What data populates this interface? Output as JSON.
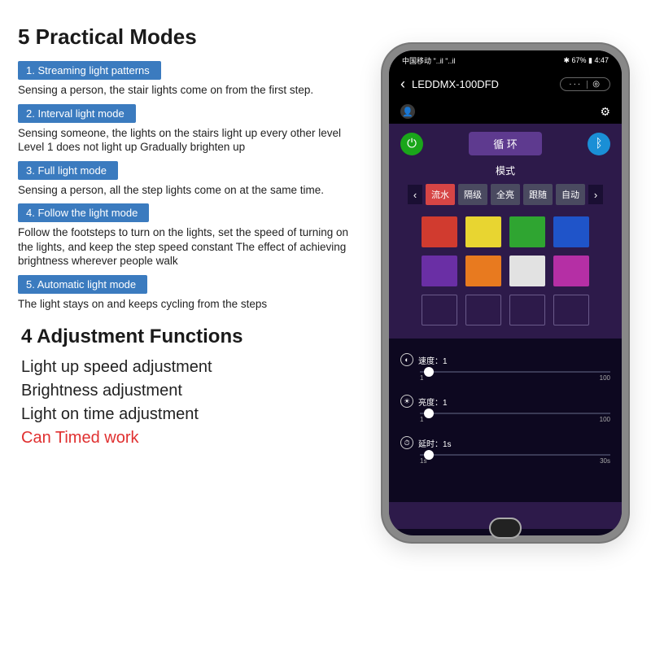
{
  "left": {
    "title1": "5 Practical Modes",
    "modes": [
      {
        "badge": "1. Streaming light patterns",
        "desc": "Sensing a person, the stair lights come on from the first step."
      },
      {
        "badge": "2. Interval light mode",
        "desc": "Sensing someone, the lights on the stairs light up every other level Level 1 does not light up Gradually brighten up"
      },
      {
        "badge": "3. Full light mode",
        "desc": "Sensing a person, all the step lights come on at the same time."
      },
      {
        "badge": "4. Follow the light mode",
        "desc": "Follow the footsteps to turn on the lights, set the speed of turning on the lights, and keep the step speed constant The effect of achieving brightness wherever people walk"
      },
      {
        "badge": "5. Automatic light mode",
        "desc": "The light stays on and keeps cycling from the steps"
      }
    ],
    "title2": "4 Adjustment Functions",
    "funcs": [
      "Light up speed adjustment",
      "Brightness adjustment",
      "Light on time adjustment",
      "Can Timed work"
    ]
  },
  "phone": {
    "status_left": "中国移动 \"..il \"..il",
    "status_right": "✱ 67% ▮ 4:47",
    "nav_back": "‹",
    "nav_title": "LEDDMX-100DFD",
    "nav_menu": "··· | ⦿",
    "pill_label": "循 环",
    "modes_label": "模式",
    "tabs": [
      "流水",
      "隔级",
      "全亮",
      "跟随",
      "自动"
    ],
    "colors_row1": [
      "#d13b2f",
      "#e8d531",
      "#2fa531",
      "#1f54c9"
    ],
    "colors_row2": [
      "#6a2fa5",
      "#e87a1f",
      "#e2e2e2",
      "#b52fa5"
    ],
    "sliders": [
      {
        "label": "速度：1",
        "min": "1",
        "max": "100"
      },
      {
        "label": "亮度：1",
        "min": "1",
        "max": "100"
      },
      {
        "label": "延时：1s",
        "min": "1s",
        "max": "30s"
      }
    ]
  }
}
